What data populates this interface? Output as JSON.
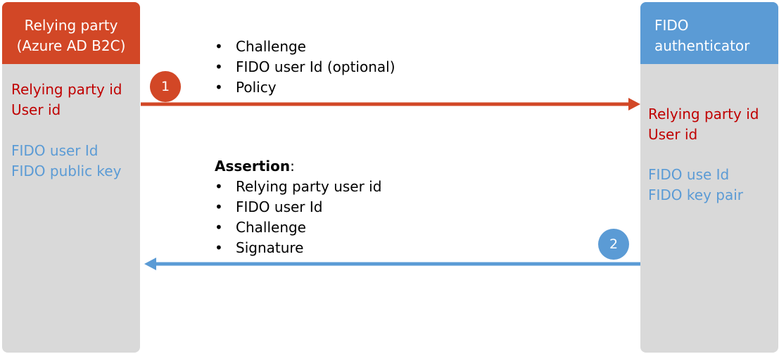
{
  "relying_party": {
    "header_line1": "Relying party",
    "header_line2": "(Azure AD B2C)",
    "red_lines": [
      "Relying party id",
      "User id"
    ],
    "blue_lines": [
      "FIDO user Id",
      "FIDO public key"
    ]
  },
  "authenticator": {
    "header_line1": "FIDO",
    "header_line2": "authenticator",
    "red_lines": [
      "Relying party id",
      "User id"
    ],
    "blue_lines": [
      "FIDO use Id",
      "FIDO key pair"
    ]
  },
  "steps": [
    {
      "number": "1",
      "direction": "to-authenticator",
      "items": [
        "Challenge",
        "FIDO user Id (optional)",
        "Policy"
      ]
    },
    {
      "number": "2",
      "direction": "to-relying-party",
      "title": "Assertion",
      "title_suffix": ":",
      "items": [
        "Relying party user id",
        "FIDO user Id",
        "Challenge",
        "Signature"
      ]
    }
  ],
  "colors": {
    "relying_party": "#d24726",
    "authenticator": "#5b9bd5",
    "column_body": "#d9d9d9",
    "red_text": "#c00000",
    "blue_text": "#5b9bd5"
  }
}
